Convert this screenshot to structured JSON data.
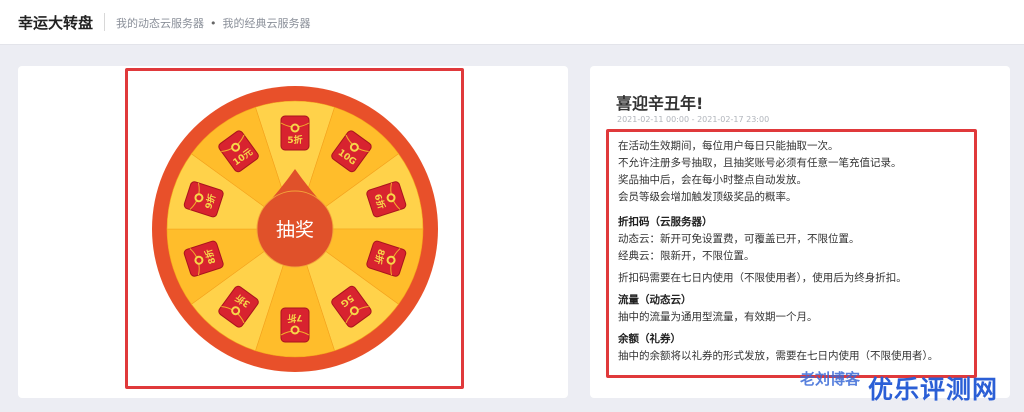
{
  "header": {
    "title": "幸运大转盘",
    "nav_items": [
      {
        "label": "我的动态云服务器"
      },
      {
        "label": "我的经典云服务器"
      }
    ],
    "separator": "•"
  },
  "wheel": {
    "center_label": "抽奖",
    "prizes": [
      "5折",
      "10G",
      "6折",
      "8折",
      "5G",
      "7折",
      "3折",
      "8折",
      "9折",
      "10元"
    ],
    "colors": {
      "rim": "#e8502a",
      "slice_light": "#ffd24a",
      "slice_dark": "#ffbd2b",
      "envelope": "#d8232f",
      "center": "#e0512a",
      "text": "#f7d64a"
    }
  },
  "promo": {
    "title": "喜迎辛丑年!",
    "date_range": "2021-02-11 00:00 - 2021-02-17 23:00",
    "rules": [
      "在活动生效期间，每位用户每日只能抽取一次。",
      "不允许注册多号抽取，且抽奖账号必须有任意一笔充值记录。",
      "奖品抽中后，会在每小时整点自动发放。",
      "会员等级会增加触发顶级奖品的概率。"
    ],
    "discount_title": "折扣码（云服务器）",
    "discount_lines": [
      "动态云：新开可免设置费，可覆盖已开，不限位置。",
      "经典云：限新开，不限位置。"
    ],
    "discount_note": "折扣码需要在七日内使用（不限使用者），使用后为终身折扣。",
    "traffic_title": "流量（动态云）",
    "traffic_line": "抽中的流量为通用型流量，有效期一个月。",
    "balance_title": "余额（礼券）",
    "balance_line": "抽中的余额将以礼券的形式发放，需要在七日内使用（不限使用者）。"
  },
  "watermarks": {
    "small": "老刘博客",
    "big": "优乐评测网"
  }
}
